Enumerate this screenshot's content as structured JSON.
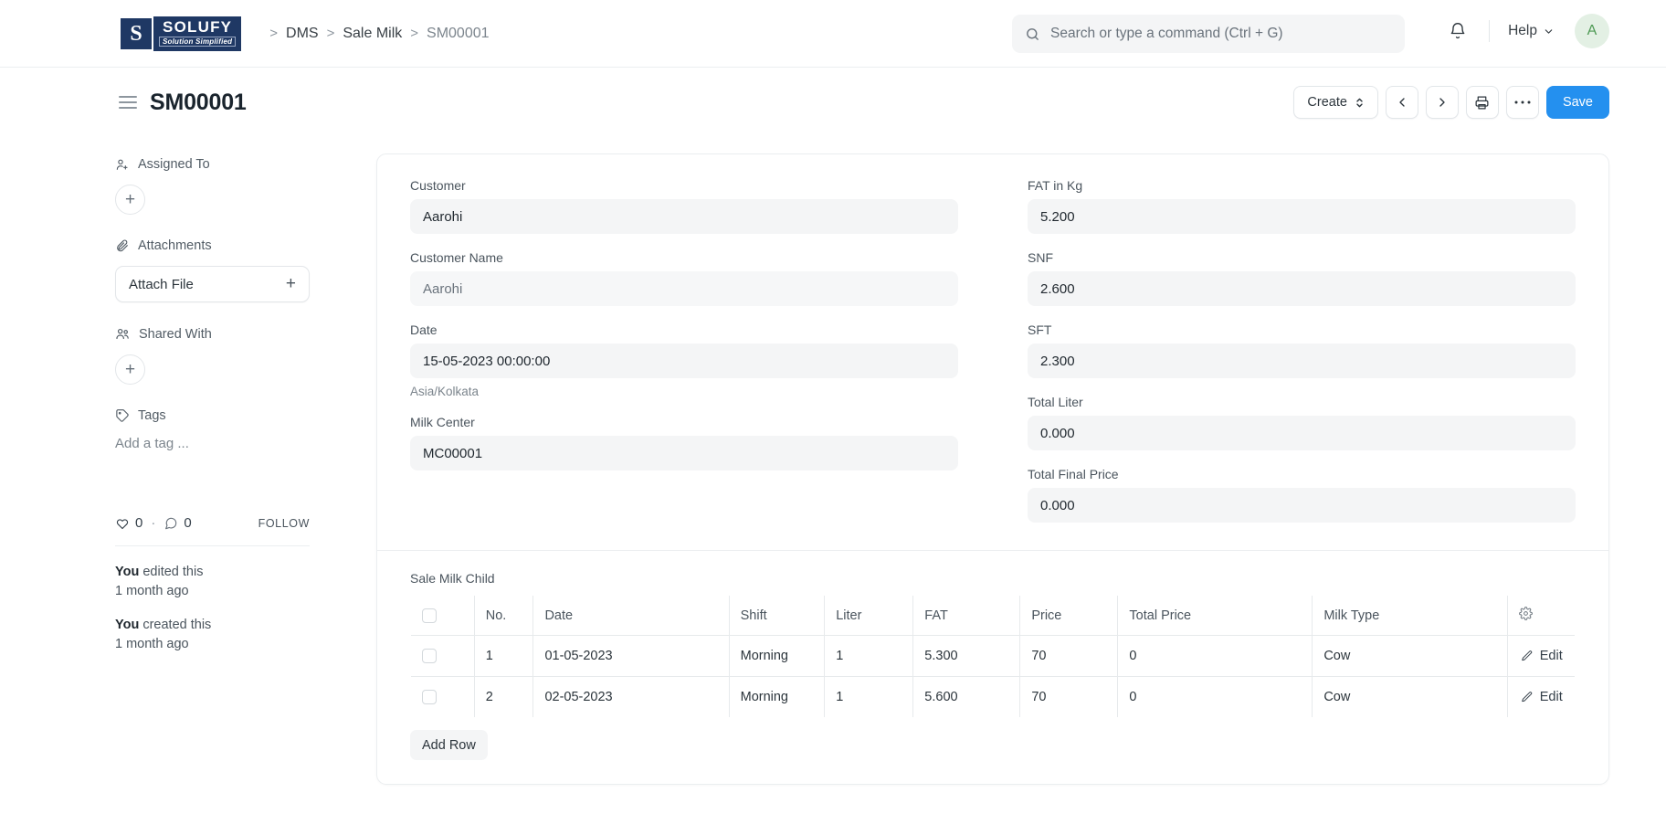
{
  "brand": {
    "mark_letter": "S",
    "name": "SOLUFY",
    "tagline": "Solution Simplified"
  },
  "breadcrumb": {
    "items": [
      "DMS",
      "Sale Milk",
      "SM00001"
    ],
    "separator": ">"
  },
  "search": {
    "placeholder": "Search or type a command (Ctrl + G)"
  },
  "navbar": {
    "help_label": "Help",
    "avatar_initial": "A"
  },
  "page_head": {
    "title": "SM00001",
    "create_label": "Create",
    "save_label": "Save"
  },
  "sidebar": {
    "assigned_to": {
      "label": "Assigned To",
      "add": "+"
    },
    "attachments": {
      "label": "Attachments",
      "attach_label": "Attach File",
      "add": "+"
    },
    "shared_with": {
      "label": "Shared With",
      "add": "+"
    },
    "tags": {
      "label": "Tags",
      "add_tag": "Add a tag ..."
    },
    "social": {
      "likes": "0",
      "dot": "·",
      "comments": "0",
      "follow": "FOLLOW"
    },
    "activity": [
      {
        "who": "You",
        "what": " edited this",
        "when": "1 month ago"
      },
      {
        "who": "You",
        "what": " created this",
        "when": "1 month ago"
      }
    ]
  },
  "form": {
    "left": [
      {
        "label": "Customer",
        "value": "Aarohi",
        "muted": false,
        "help": ""
      },
      {
        "label": "Customer Name",
        "value": "Aarohi",
        "muted": true,
        "help": ""
      },
      {
        "label": "Date",
        "value": "15-05-2023 00:00:00",
        "muted": false,
        "help": "Asia/Kolkata"
      },
      {
        "label": "Milk Center",
        "value": "MC00001",
        "muted": false,
        "help": ""
      }
    ],
    "right": [
      {
        "label": "FAT in Kg",
        "value": "5.200",
        "muted": false,
        "help": ""
      },
      {
        "label": "SNF",
        "value": "2.600",
        "muted": false,
        "help": ""
      },
      {
        "label": "SFT",
        "value": "2.300",
        "muted": false,
        "help": ""
      },
      {
        "label": "Total Liter",
        "value": "0.000",
        "muted": false,
        "help": ""
      },
      {
        "label": "Total Final Price",
        "value": "0.000",
        "muted": false,
        "help": ""
      }
    ]
  },
  "grid": {
    "title": "Sale Milk Child",
    "columns": [
      "No.",
      "Date",
      "Shift",
      "Liter",
      "FAT",
      "Price",
      "Total Price",
      "Milk Type"
    ],
    "settings_icon": "gear-icon",
    "rows": [
      {
        "no": "1",
        "date": "01-05-2023",
        "shift": "Morning",
        "liter": "1",
        "fat": "5.300",
        "price": "70",
        "total_price": "0",
        "milk_type": "Cow",
        "edit_label": "Edit"
      },
      {
        "no": "2",
        "date": "02-05-2023",
        "shift": "Morning",
        "liter": "1",
        "fat": "5.600",
        "price": "70",
        "total_price": "0",
        "milk_type": "Cow",
        "edit_label": "Edit"
      }
    ],
    "add_row_label": "Add Row"
  },
  "colors": {
    "primary": "#2490ef",
    "brand_navy": "#1f3864",
    "avatar_bg": "#e3f0e4",
    "avatar_fg": "#4f9a55",
    "field_bg": "#f4f5f6",
    "border": "#ebeef0"
  }
}
